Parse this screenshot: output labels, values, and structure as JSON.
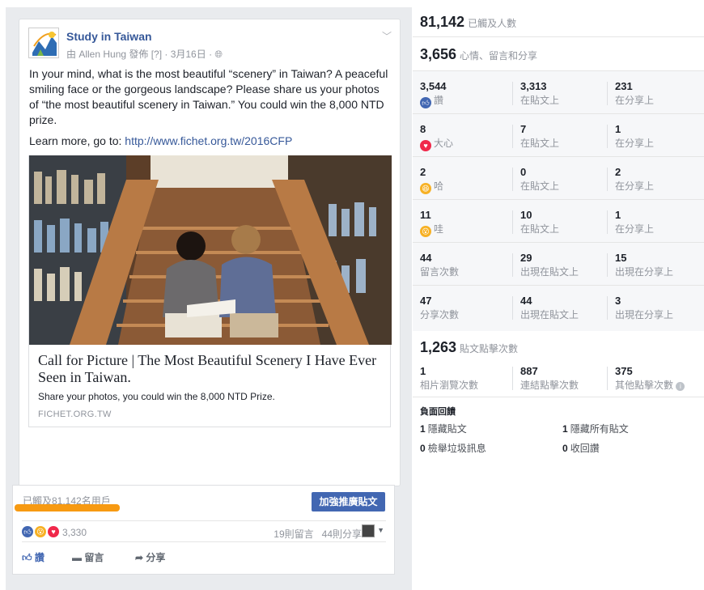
{
  "post": {
    "page_name": "Study in Taiwan",
    "meta": "由 Allen Hung 發佈 [?] · 3月16日 · ",
    "globe_icon": "globe-icon",
    "text_para1": "In your mind, what is the most beautiful “scenery” in Taiwan? A peaceful smiling face or the gorgeous landscape? Please share us your photos of “the most beautiful scenery in Taiwan.” You could win the 8,000 NTD prize.",
    "text_para2_prefix": "Learn more, go to: ",
    "text_link": "http://www.fichet.org.tw/2016CFP",
    "link_title": "Call for Picture | The Most Beautiful Scenery I Have Ever Seen in Taiwan.",
    "link_desc": "Share your photos, you could win the 8,000 NTD Prize.",
    "link_domain": "FICHET.ORG.TW"
  },
  "reach_bar": {
    "text": "已觸及81,142名用戶",
    "boost_label": "加強推廣貼文"
  },
  "footer": {
    "reaction_count": "3,330",
    "comments": "19則留言",
    "shares": "44則分享",
    "like_label": "讚",
    "comment_label": "留言",
    "share_label": "分享"
  },
  "insights": {
    "reach_num": "81,142",
    "reach_label": "已觸及人數",
    "engage_num": "3,656",
    "engage_label": "心情、留言和分享",
    "rows": [
      {
        "c1n": "3,544",
        "c1t": "讚",
        "c2n": "3,313",
        "c2t": "在貼文上",
        "c3n": "231",
        "c3t": "在分享上"
      },
      {
        "c1n": "8",
        "c1t": "大心",
        "c2n": "7",
        "c2t": "在貼文上",
        "c3n": "1",
        "c3t": "在分享上"
      },
      {
        "c1n": "2",
        "c1t": "哈",
        "c2n": "0",
        "c2t": "在貼文上",
        "c3n": "2",
        "c3t": "在分享上"
      },
      {
        "c1n": "11",
        "c1t": "哇",
        "c2n": "10",
        "c2t": "在貼文上",
        "c3n": "1",
        "c3t": "在分享上"
      },
      {
        "c1n": "44",
        "c1t": "留言次數",
        "c2n": "29",
        "c2t": "出現在貼文上",
        "c3n": "15",
        "c3t": "出現在分享上"
      },
      {
        "c1n": "47",
        "c1t": "分享次數",
        "c2n": "44",
        "c2t": "出現在貼文上",
        "c3n": "3",
        "c3t": "出現在分享上"
      }
    ],
    "clicks_num": "1,263",
    "clicks_label": "貼文點擊次數",
    "clicks": [
      {
        "n": "1",
        "t": "相片瀏覽次數"
      },
      {
        "n": "887",
        "t": "連結點擊次數"
      },
      {
        "n": "375",
        "t": "其他點擊次數"
      }
    ],
    "neg_title": "負面回饋",
    "neg": [
      {
        "n": "1",
        "t": "隱藏貼文"
      },
      {
        "n": "1",
        "t": "隱藏所有貼文"
      },
      {
        "n": "0",
        "t": "檢舉垃圾訊息"
      },
      {
        "n": "0",
        "t": "收回讚"
      }
    ]
  },
  "colors": {
    "brand_blue": "#4267b2",
    "link_blue": "#365899",
    "orange_highlight": "#f79a12",
    "love_red": "#f0284a",
    "haha_yellow": "#f7b125"
  }
}
